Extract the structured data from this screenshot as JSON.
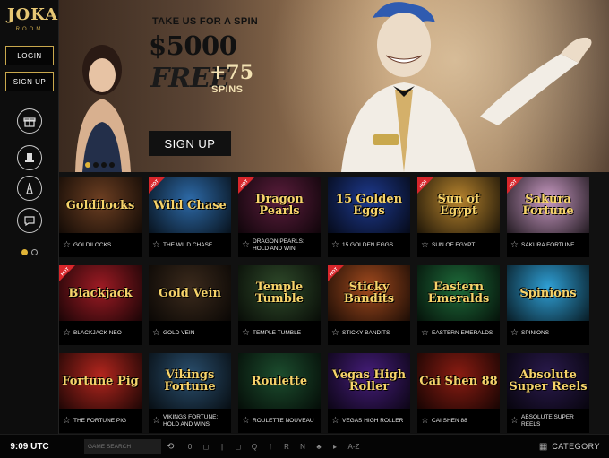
{
  "sidebar": {
    "logo": "JOKA",
    "logo_sub": "ROOM",
    "login_label": "LOGIN",
    "signup_label": "SIGN UP",
    "icons": [
      "gift-icon",
      "top-hat-icon",
      "tower-icon",
      "chat-icon"
    ],
    "page_dots": 2,
    "active_dot": 0
  },
  "banner": {
    "tagline": "TAKE US FOR A SPIN",
    "amount": "$5000",
    "free": "FREE",
    "plus": "+75",
    "spins": "SPINS",
    "signup_label": "SIGN UP",
    "slides": 4,
    "active_slide": 0,
    "accent": "#e0b437"
  },
  "games": [
    {
      "name": "GOLDILOCKS",
      "thumb": "Goldilocks",
      "hot": false,
      "color": "#6d3f22"
    },
    {
      "name": "THE WILD CHASE",
      "thumb": "Wild Chase",
      "hot": true,
      "color": "#2d6aa8"
    },
    {
      "name": "DRAGON PEARLS: HOLD AND WIN",
      "thumb": "Dragon Pearls",
      "hot": true,
      "color": "#5b1d3c"
    },
    {
      "name": "15 GOLDEN EGGS",
      "thumb": "15 Golden Eggs",
      "hot": false,
      "color": "#1e3a8f"
    },
    {
      "name": "SUN OF EGYPT",
      "thumb": "Sun of Egypt",
      "hot": true,
      "color": "#b7842e"
    },
    {
      "name": "SAKURA FORTUNE",
      "thumb": "Sakura Fortune",
      "hot": true,
      "color": "#c99ac3"
    },
    {
      "name": "BLACKJACK NEO",
      "thumb": "Blackjack",
      "hot": true,
      "color": "#9e1b24"
    },
    {
      "name": "GOLD VEIN",
      "thumb": "Gold Vein",
      "hot": false,
      "color": "#3b2a1c"
    },
    {
      "name": "TEMPLE TUMBLE",
      "thumb": "Temple Tumble",
      "hot": false,
      "color": "#2f4a2a"
    },
    {
      "name": "STICKY BANDITS",
      "thumb": "Sticky Bandits",
      "hot": true,
      "color": "#a24a1e"
    },
    {
      "name": "EASTERN EMERALDS",
      "thumb": "Eastern Emeralds",
      "hot": false,
      "color": "#1e6b3a"
    },
    {
      "name": "SPINIONS",
      "thumb": "Spinions",
      "hot": false,
      "color": "#2fa0d6"
    },
    {
      "name": "THE FORTUNE PIG",
      "thumb": "Fortune Pig",
      "hot": false,
      "color": "#b3261e"
    },
    {
      "name": "VIKINGS FORTUNE: HOLD AND WINS",
      "thumb": "Vikings Fortune",
      "hot": false,
      "color": "#2a4f6e"
    },
    {
      "name": "ROULETTE NOUVEAU",
      "thumb": "Roulette",
      "hot": false,
      "color": "#1c4d2e"
    },
    {
      "name": "VEGAS HIGH ROLLER",
      "thumb": "Vegas High Roller",
      "hot": false,
      "color": "#451d7a"
    },
    {
      "name": "CAI SHEN 88",
      "thumb": "Cai Shen 88",
      "hot": false,
      "color": "#8a1c12"
    },
    {
      "name": "ABSOLUTE SUPER REELS",
      "thumb": "Absolute Super Reels",
      "hot": false,
      "color": "#2a1a4d"
    }
  ],
  "hot_label": "HOT",
  "footer": {
    "time": "9:09 UTC",
    "search_placeholder": "GAME SEARCH",
    "filters": [
      "history-icon",
      "0",
      "◻",
      "|",
      "◻",
      "Q",
      "†",
      "R",
      "N",
      "♣",
      "▸",
      "A-Z"
    ],
    "category_label": "CATEGORY"
  }
}
